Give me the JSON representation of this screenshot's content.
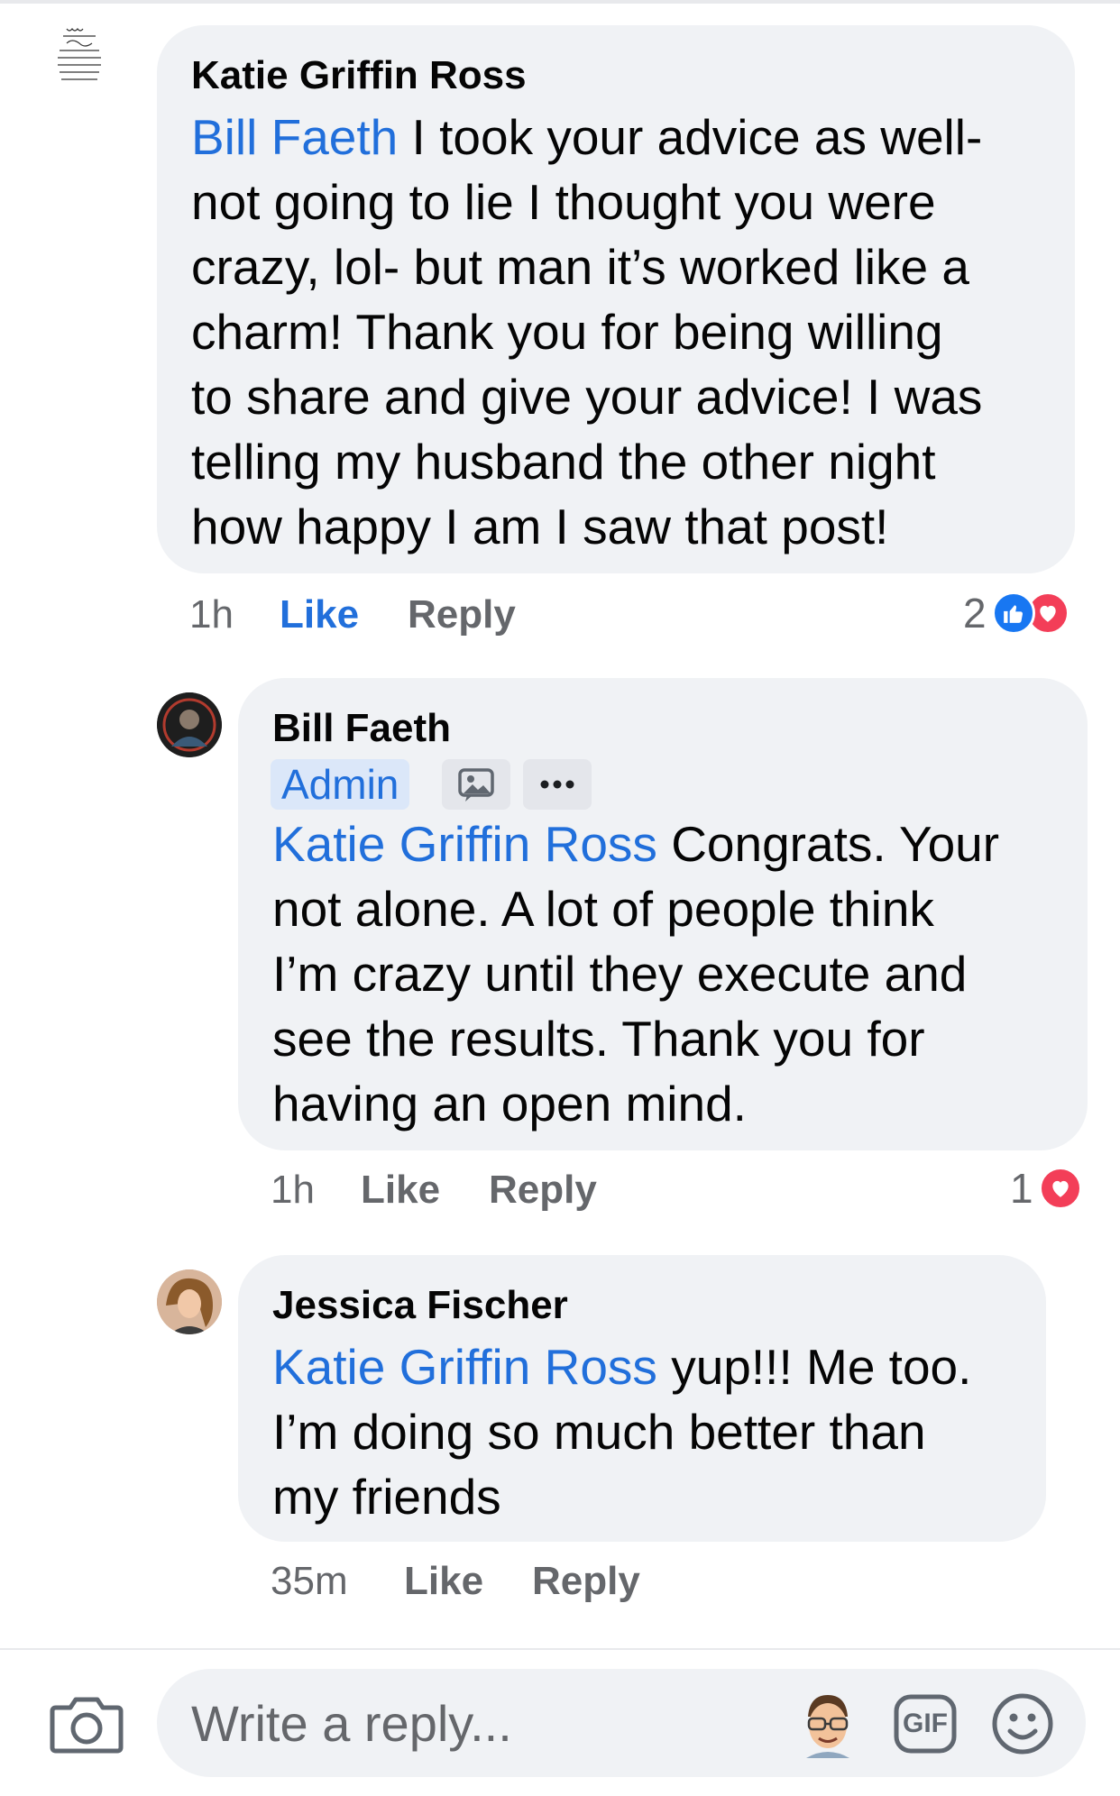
{
  "comments": [
    {
      "author": "Katie Griffin Ross",
      "avatar": "joy-quote-avatar",
      "lines": [
        {
          "mention": "Bill Faeth",
          "text": " I took your advice as well-"
        },
        {
          "text": "not going to lie I thought you were"
        },
        {
          "text": "crazy, lol- but man it’s worked like a"
        },
        {
          "text": "charm!  Thank you for being willing"
        },
        {
          "text": "to share and give your advice!  I was"
        },
        {
          "text": "telling my husband the other night"
        },
        {
          "text": "how happy I am I saw that post!"
        }
      ],
      "time": "1h",
      "like_label": "Like",
      "reply_label": "Reply",
      "liked": true,
      "reaction_count": "2",
      "reactions": [
        "like-icon",
        "love-icon"
      ]
    },
    {
      "author": "Bill Faeth",
      "avatar": "profile-photo-avatar",
      "badge": "Admin",
      "lines": [
        {
          "mention": "Katie Griffin Ross",
          "text": "  Congrats. Your"
        },
        {
          "text": "not alone. A lot of people think"
        },
        {
          "text": "I’m crazy until they execute and"
        },
        {
          "text": "see the results. Thank you for"
        },
        {
          "text": "having an open mind."
        }
      ],
      "time": "1h",
      "like_label": "Like",
      "reply_label": "Reply",
      "liked": false,
      "reaction_count": "1",
      "reactions": [
        "love-icon"
      ]
    },
    {
      "author": "Jessica Fischer",
      "avatar": "profile-photo-avatar",
      "lines": [
        {
          "mention": "Katie Griffin Ross",
          "text": " yup!!! Me too."
        },
        {
          "text": "I’m doing so much better than"
        },
        {
          "text": "my friends"
        }
      ],
      "time": "35m",
      "like_label": "Like",
      "reply_label": "Reply",
      "liked": false
    }
  ],
  "composer": {
    "placeholder": "Write a reply...",
    "gif_label": "GIF",
    "icons": [
      "camera-icon",
      "avatar-sticker-icon",
      "gif-icon",
      "emoji-icon"
    ]
  },
  "colors": {
    "mention": "#216fdb",
    "bubble": "#f0f2f5",
    "meta": "#65676b",
    "like_blue": "#1877f2",
    "love_red": "#f33e58"
  }
}
